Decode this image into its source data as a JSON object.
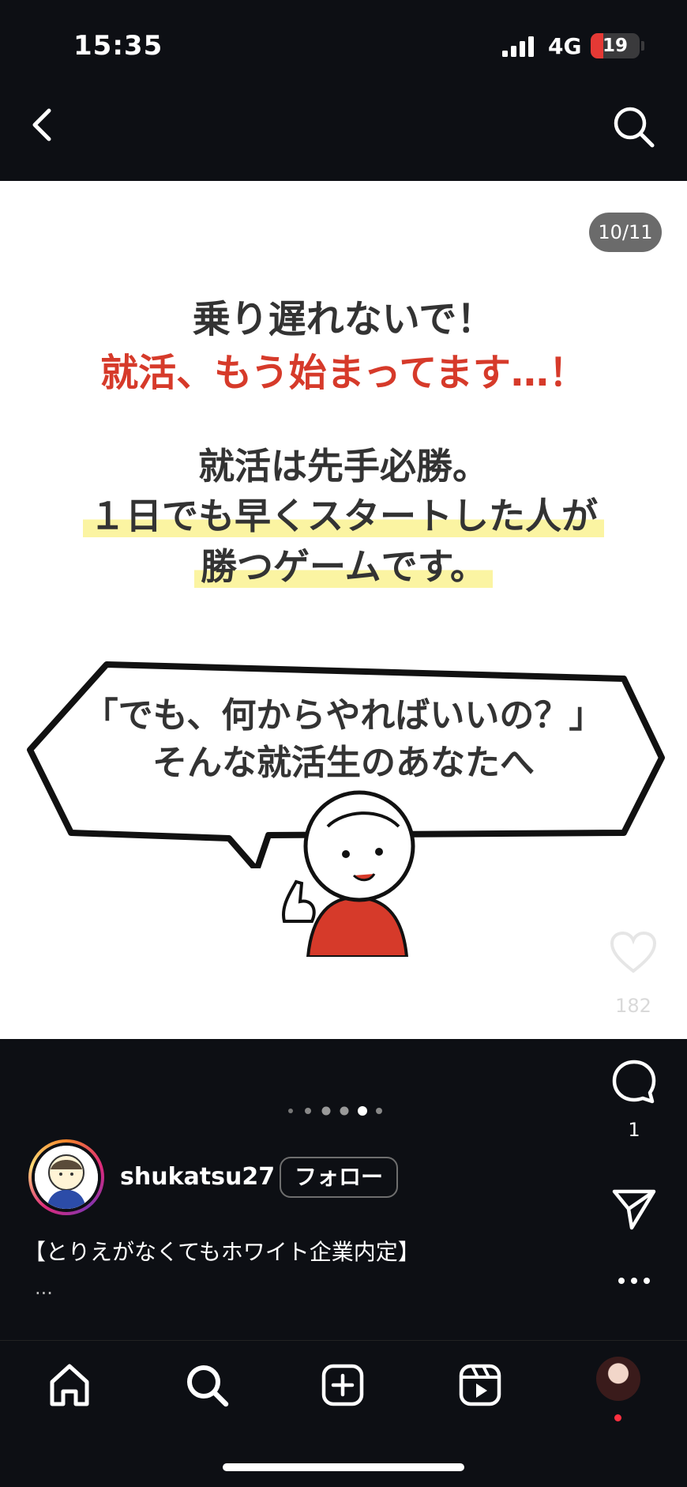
{
  "status_bar": {
    "time": "15:35",
    "network": "4G",
    "battery": "19"
  },
  "post": {
    "counter": "10/11",
    "heading_1": "乗り遅れないで！",
    "heading_2": "就活、もう始まってます…！",
    "body_1": "就活は先手必勝。",
    "body_2": "１日でも早くスタートした人が",
    "body_3": "勝つゲームです。",
    "bubble_1": "「でも、何からやればいいの？」",
    "bubble_2": "そんな就活生のあなたへ",
    "likes": "182"
  },
  "actions": {
    "comments": "1"
  },
  "carousel": {
    "active_index": 3,
    "total_visible_dots": 6
  },
  "account": {
    "username": "shukatsu27",
    "follow_label": "フォロー"
  },
  "caption": {
    "text": "【とりえがなくてもホワイト企業内定】",
    "more": "..."
  },
  "icons": {
    "back": "chevron-left-icon",
    "search": "search-icon",
    "like": "heart-icon",
    "comment": "comment-icon",
    "share": "paper-plane-icon",
    "more": "more-dots-icon",
    "home": "home-icon",
    "explore": "search-icon",
    "create": "plus-square-icon",
    "reels": "reels-icon"
  },
  "colors": {
    "accent_red": "#d63a2a",
    "highlight_yellow": "#fbf4a2",
    "background": "#0d0f14"
  }
}
